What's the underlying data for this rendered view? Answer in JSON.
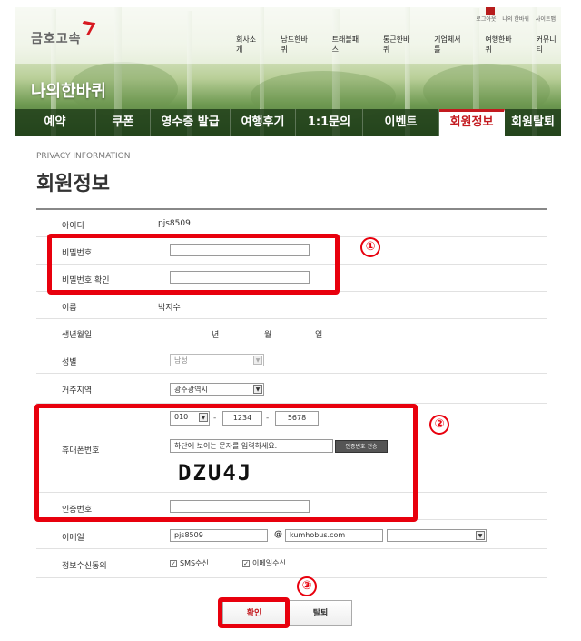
{
  "header": {
    "logo_text": "금호고속",
    "util_links": [
      "로그아웃",
      "나의 한바퀴",
      "사이트맵"
    ],
    "gnb": [
      "회사소개",
      "남도한바퀴",
      "트래블패스",
      "통근한바퀴",
      "기업체서틀",
      "여행한바퀴",
      "커뮤니티"
    ],
    "hero_title": "나의한바퀴",
    "tabs": [
      {
        "label": "예약",
        "active": false
      },
      {
        "label": "쿠폰",
        "active": false
      },
      {
        "label": "영수증 발급",
        "active": false
      },
      {
        "label": "여행후기",
        "active": false
      },
      {
        "label": "1:1문의",
        "active": false
      },
      {
        "label": "이벤트",
        "active": false
      },
      {
        "label": "회원정보",
        "active": true
      },
      {
        "label": "회원탈퇴",
        "active": false
      }
    ]
  },
  "page": {
    "eng_title": "PRIVACY INFORMATION",
    "title": "회원정보"
  },
  "form": {
    "id_label": "아이디",
    "id_value": "pjs8509",
    "password_label": "비밀번호",
    "password_confirm_label": "비밀번호 확인",
    "name_label": "이름",
    "name_value": "박지수",
    "birth_label": "생년월일",
    "birth_units": [
      "년",
      "월",
      "일"
    ],
    "gender_label": "성별",
    "gender_value": "남성",
    "region_label": "거주지역",
    "region_value": "광주광역시",
    "phone_label": "휴대폰번호",
    "phone_prefix": "010",
    "phone_middle": "1234",
    "phone_last": "5678",
    "phone_sep": "-",
    "captcha_placeholder": "하단에 보이는 문자를 입력하세요.",
    "send_code_label": "인증번호 전송",
    "captcha_text": "DZU4J",
    "auth_label": "인증번호",
    "email_label": "이메일",
    "email_id": "pjs8509",
    "email_at": "@",
    "email_domain": "kumhobus.com",
    "consent_label": "정보수신동의",
    "consent_sms": "SMS수신",
    "consent_email": "이메일수신"
  },
  "buttons": {
    "confirm": "확인",
    "withdraw": "탈퇴"
  },
  "callouts": [
    "①",
    "②",
    "③"
  ],
  "colors": {
    "accent": "#e8000d",
    "tab_active": "#c31a1f",
    "tab_bar": "#2d4f22"
  }
}
